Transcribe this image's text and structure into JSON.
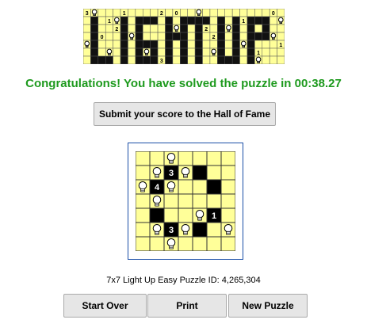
{
  "header": {
    "logo_text": "LIGHT UP"
  },
  "message": {
    "congrats": "Congratulations! You have solved the puzzle in 00:38.27",
    "color": "#1e9a1e"
  },
  "buttons": {
    "submit_label": "Submit your score to the Hall of Fame",
    "start_over_label": "Start Over",
    "print_label": "Print",
    "new_puzzle_label": "New Puzzle"
  },
  "board": {
    "size": 7,
    "colors": {
      "lit": "#ffff99",
      "wall": "#000000",
      "grid": "#333333"
    },
    "rows": [
      [
        ".",
        ".",
        "B",
        ".",
        ".",
        ".",
        "."
      ],
      [
        ".",
        "B",
        "3",
        "B",
        "W",
        ".",
        "."
      ],
      [
        "B",
        "4",
        "B",
        ".",
        ".",
        "W",
        "."
      ],
      [
        ".",
        "B",
        ".",
        ".",
        ".",
        ".",
        "."
      ],
      [
        ".",
        "W",
        ".",
        ".",
        "B",
        "1",
        "."
      ],
      [
        ".",
        "B",
        "3",
        "B",
        "W",
        ".",
        "B"
      ],
      [
        ".",
        ".",
        "B",
        ".",
        ".",
        ".",
        "."
      ]
    ]
  },
  "puzzle_info": "7x7 Light Up Easy Puzzle ID: 4,265,304"
}
